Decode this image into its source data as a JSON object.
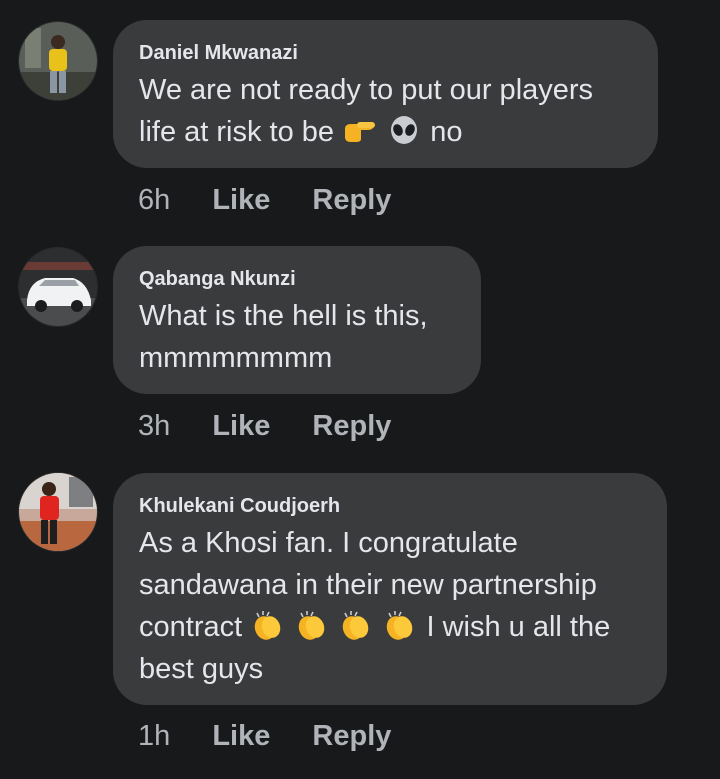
{
  "comments": [
    {
      "author": "Daniel Mkwanazi",
      "lines": [
        "We are not ready to put our players",
        "life at risk to be",
        "no"
      ],
      "emojis": [
        "pointing-hand-emoji",
        "alien-emoji"
      ],
      "time": "6h",
      "like_label": "Like",
      "reply_label": "Reply"
    },
    {
      "author": "Qabanga Nkunzi",
      "lines": [
        "What is the hell is this,",
        "mmmmmmmm"
      ],
      "time": "3h",
      "like_label": "Like",
      "reply_label": "Reply"
    },
    {
      "author": "Khulekani Coudjoerh",
      "lines": [
        "As a Khosi fan. I congratulate",
        "sandawana in their new partnership",
        "contract",
        "I wish u all the",
        "best guys"
      ],
      "emojis": [
        "clapping-hands-emoji"
      ],
      "time": "1h",
      "like_label": "Like",
      "reply_label": "Reply"
    }
  ],
  "colors": {
    "background": "#18191a",
    "bubble": "#3a3b3c",
    "primary_text": "#e4e6eb",
    "secondary_text": "#b0b3b8"
  }
}
